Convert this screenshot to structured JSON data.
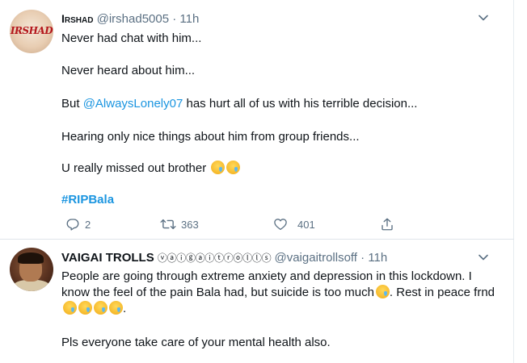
{
  "tweets": [
    {
      "name": "Irshad",
      "handle": "@irshad5005",
      "separator": "·",
      "time": "11h",
      "avatar_text": "IRSHAD",
      "lines": [
        "Never had chat with him...",
        "Never heard about him...",
        "has hurt all of us with his terrible decision...",
        "Hearing only nice things about him from group friends...",
        "U really missed out brother"
      ],
      "line3_prefix": "But",
      "mention": "@AlwaysLonely07",
      "hashtag": "#RIPBala",
      "stats": {
        "replies": "2",
        "retweets": "363",
        "likes": "401"
      }
    },
    {
      "name": "VAIGAI TROLLS",
      "name_suffix": "ⓥⓐⓘⓖⓐⓘⓣⓡⓞⓛⓛⓢ",
      "handle": "@vaigaitrollsoff",
      "separator": "·",
      "time": "11h",
      "para1": "People are going through extreme anxiety and depression in this lockdown. I know the feel of the pain Bala had, but suicide is too much",
      "para1_tail": ". Rest in peace",
      "para1_end": "frnd",
      "para2": "Pls everyone take care of your mental health also."
    }
  ],
  "colors": {
    "link": "#1b95e0",
    "muted": "#5b7083",
    "text": "#0f1419"
  },
  "icons": [
    "chevron-down-icon",
    "reply-icon",
    "retweet-icon",
    "like-icon",
    "share-icon",
    "crying-face-emoji"
  ]
}
